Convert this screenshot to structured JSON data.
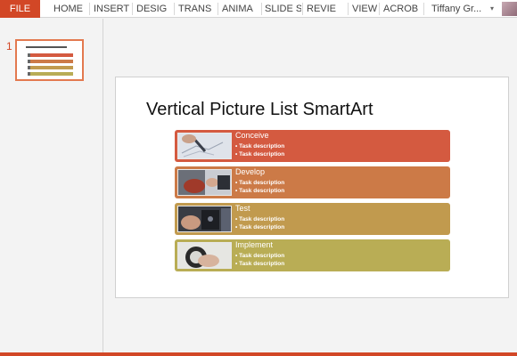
{
  "ribbon": {
    "file_label": "FILE",
    "tabs": [
      "HOME",
      "INSERT",
      "DESIG",
      "TRANS",
      "ANIMA",
      "SLIDE S",
      "REVIE",
      "VIEW",
      "ACROB"
    ],
    "user_name": "Tiffany Gr...",
    "user_caret": "▾"
  },
  "thumbnails": {
    "number": "1"
  },
  "slide": {
    "title": "Vertical Picture List SmartArt",
    "items": [
      {
        "heading": "Conceive",
        "bullets": [
          "• Task description",
          "• Task description"
        ],
        "color": "#d45a40"
      },
      {
        "heading": "Develop",
        "bullets": [
          "• Task description",
          "• Task description"
        ],
        "color": "#cc7a47"
      },
      {
        "heading": "Test",
        "bullets": [
          "• Task description",
          "• Task description"
        ],
        "color": "#c19a4e"
      },
      {
        "heading": "Implement",
        "bullets": [
          "• Task description",
          "• Task description"
        ],
        "color": "#b9ad55"
      }
    ]
  },
  "colors": {
    "accent": "#d24726"
  }
}
